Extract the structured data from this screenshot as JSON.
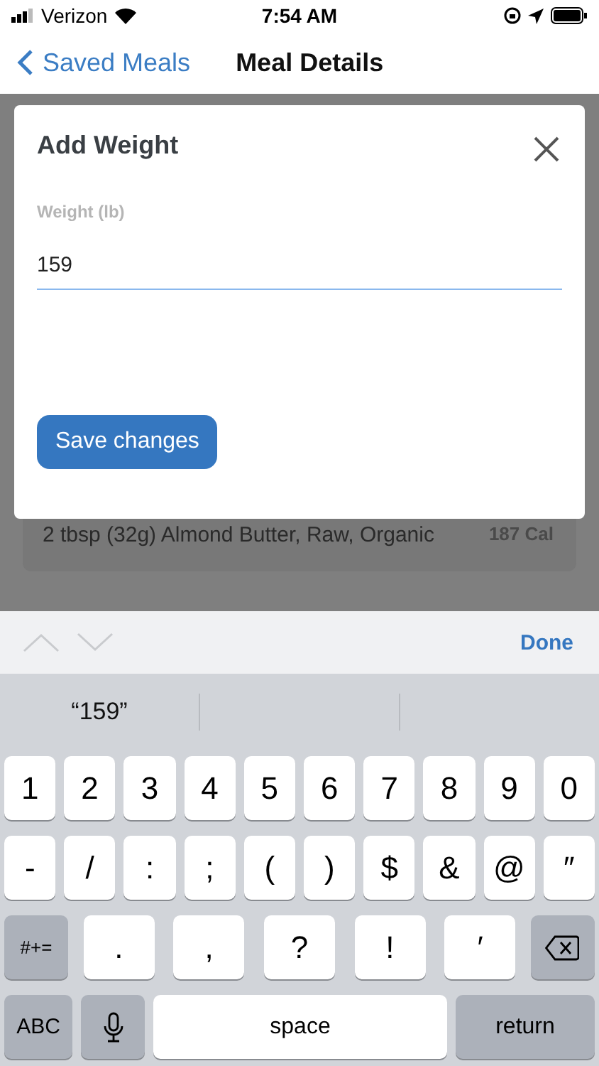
{
  "status_bar": {
    "carrier": "Verizon",
    "time": "7:54 AM"
  },
  "nav_bar": {
    "back_label": "Saved Meals",
    "title": "Meal Details"
  },
  "background_item": {
    "description": "2 tbsp (32g) Almond Butter, Raw, Organic",
    "calories": "187 Cal"
  },
  "modal": {
    "title": "Add Weight",
    "field": {
      "label": "Weight (lb)",
      "value": "159"
    },
    "save_button": "Save changes"
  },
  "keyboard_toolbar": {
    "arrows": [
      {
        "kind": "up",
        "disabled": true
      },
      {
        "kind": "down",
        "disabled": true
      }
    ],
    "done": "Done"
  },
  "suggestions": [
    "“159”"
  ],
  "keyboard_rows": [
    [
      {
        "kind": "char",
        "label": "1"
      },
      {
        "kind": "char",
        "label": "2"
      },
      {
        "kind": "char",
        "label": "3"
      },
      {
        "kind": "char",
        "label": "4"
      },
      {
        "kind": "char",
        "label": "5"
      },
      {
        "kind": "char",
        "label": "6"
      },
      {
        "kind": "char",
        "label": "7"
      },
      {
        "kind": "char",
        "label": "8"
      },
      {
        "kind": "char",
        "label": "9"
      },
      {
        "kind": "char",
        "label": "0"
      }
    ],
    [
      {
        "kind": "char",
        "label": "-"
      },
      {
        "kind": "char",
        "label": "/"
      },
      {
        "kind": "char",
        "label": ":"
      },
      {
        "kind": "char",
        "label": ";"
      },
      {
        "kind": "char",
        "label": "("
      },
      {
        "kind": "char",
        "label": ")"
      },
      {
        "kind": "char",
        "label": "$"
      },
      {
        "kind": "char",
        "label": "&"
      },
      {
        "kind": "char",
        "label": "@"
      },
      {
        "kind": "char",
        "label": "″"
      }
    ],
    [
      {
        "kind": "function",
        "label": "#+="
      },
      {
        "kind": "wide",
        "label": "."
      },
      {
        "kind": "wide",
        "label": ","
      },
      {
        "kind": "wide",
        "label": "?"
      },
      {
        "kind": "wide",
        "label": "!"
      },
      {
        "kind": "wide",
        "label": "′"
      },
      {
        "kind": "backspace"
      }
    ],
    [
      {
        "kind": "function",
        "label": "ABC"
      },
      {
        "kind": "mic"
      },
      {
        "kind": "space",
        "label": "space"
      },
      {
        "kind": "return",
        "label": "return"
      }
    ]
  ]
}
